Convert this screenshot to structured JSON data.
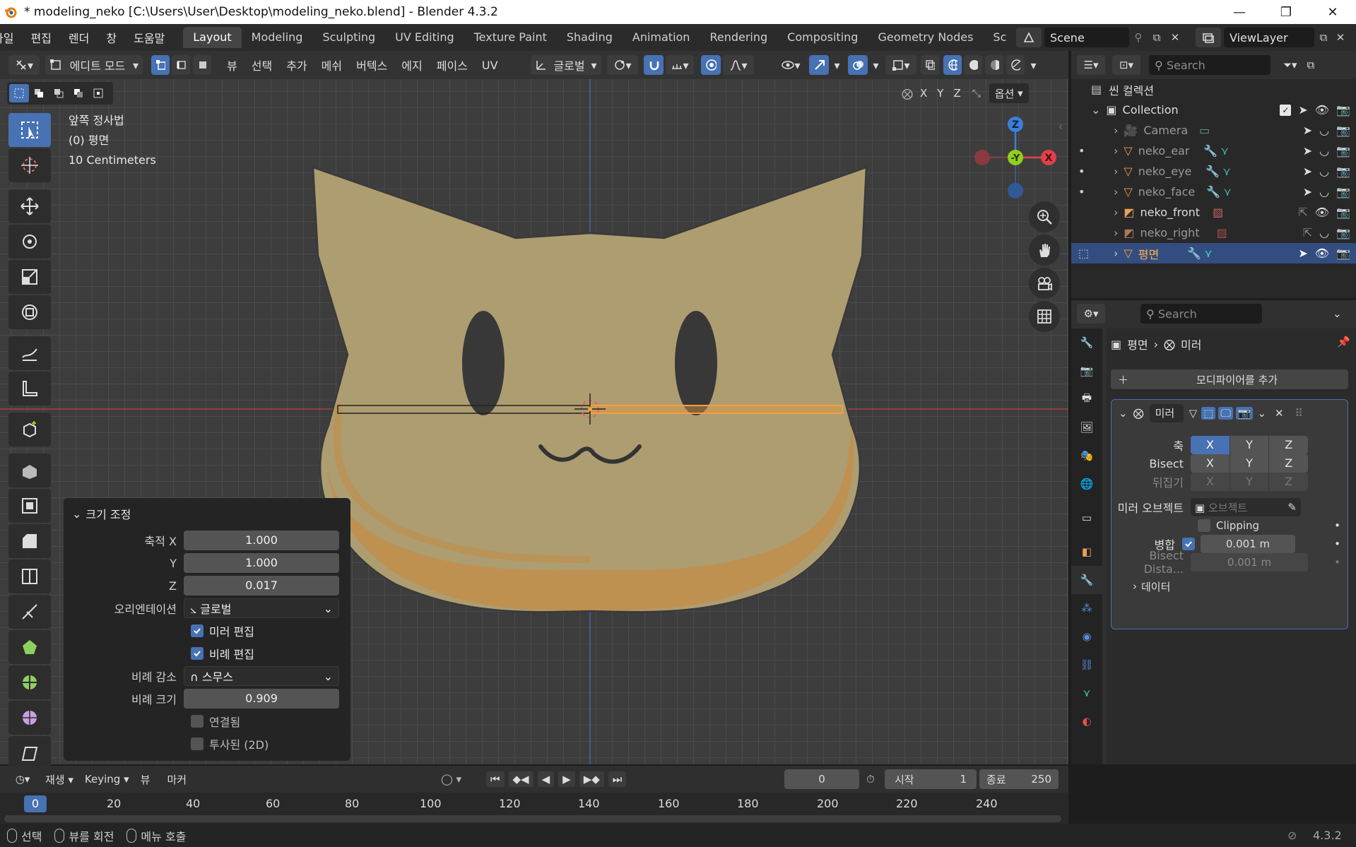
{
  "window": {
    "title": "* modeling_neko [C:\\Users\\User\\Desktop\\modeling_neko.blend] - Blender 4.3.2"
  },
  "menu": [
    "파일",
    "편집",
    "렌더",
    "창",
    "도움말"
  ],
  "workspaces": [
    "Layout",
    "Modeling",
    "Sculpting",
    "UV Editing",
    "Texture Paint",
    "Shading",
    "Animation",
    "Rendering",
    "Compositing",
    "Geometry Nodes",
    "Sc"
  ],
  "scene": {
    "name": "Scene",
    "view_layer": "ViewLayer"
  },
  "viewport_header": {
    "mode": "에디트 모드",
    "menus": [
      "뷰",
      "선택",
      "추가",
      "메쉬",
      "버텍스",
      "에지",
      "페이스",
      "UV"
    ],
    "orientation": "글로벌",
    "axes": [
      "X",
      "Y",
      "Z"
    ],
    "options": "옵션"
  },
  "viewport_info": {
    "view": "앞쪽 정사법",
    "object": "(0) 평면",
    "scale": "10 Centimeters"
  },
  "gizmo": {
    "z": "Z",
    "y": "-Y",
    "x": "X"
  },
  "operator_panel": {
    "title": "크기 조정",
    "scale_x_label": "축적 X",
    "scale_x": "1.000",
    "scale_y_label": "Y",
    "scale_y": "1.000",
    "scale_z_label": "Z",
    "scale_z": "0.017",
    "orientation_label": "오리엔테이션",
    "orientation": "글로벌",
    "mirror_edit": "미러 편집",
    "mirror_edit_checked": true,
    "proportional_edit": "비례 편집",
    "proportional_edit_checked": true,
    "falloff_label": "비례 감소",
    "falloff": "스무스",
    "prop_size_label": "비례 크기",
    "prop_size": "0.909",
    "connected": "연결됨",
    "connected_checked": false,
    "projected": "투사된 (2D)",
    "projected_checked": false
  },
  "outliner": {
    "search_placeholder": "Search",
    "scene_collection": "씬 컬렉션",
    "collection": "Collection",
    "items": [
      {
        "name": "Camera"
      },
      {
        "name": "neko_ear"
      },
      {
        "name": "neko_eye"
      },
      {
        "name": "neko_face"
      },
      {
        "name": "neko_front"
      },
      {
        "name": "neko_right"
      },
      {
        "name": "평면",
        "selected": true
      }
    ]
  },
  "properties": {
    "search_placeholder": "Search",
    "breadcrumb_object": "평면",
    "breadcrumb_modifier": "미러",
    "add_modifier": "모디파이어를 추가",
    "modifier_name": "미러",
    "axis_label": "축",
    "bisect_label": "Bisect",
    "flip_label": "뒤집기",
    "mirror_object_label": "미러 오브젝트",
    "mirror_object_placeholder": "오브젝트",
    "clipping_label": "Clipping",
    "merge_label": "병합",
    "merge_value": "0.001 m",
    "bisect_distance_label": "Bisect Dista...",
    "bisect_distance_value": "0.001 m",
    "data_label": "데이터",
    "x": "X",
    "y": "Y",
    "z": "Z"
  },
  "timeline": {
    "playback": "재생",
    "keying": "Keying",
    "view": "뷰",
    "marker": "마커",
    "current_frame": "0",
    "start_label": "시작",
    "start": "1",
    "end_label": "종료",
    "end": "250",
    "ruler": [
      "0",
      "20",
      "40",
      "60",
      "80",
      "100",
      "120",
      "140",
      "160",
      "180",
      "200",
      "220",
      "240"
    ]
  },
  "statusbar": {
    "select": "선택",
    "rotate_view": "뷰를 회전",
    "call_menu": "메뉴 호출",
    "version": "4.3.2"
  },
  "colors": {
    "accent": "#4772b3",
    "selection_orange": "#ffa033",
    "face_fill": "#b0a274",
    "x_axis": "#e0404a",
    "y_axis": "#8fcf1f",
    "z_axis": "#3c7fd6"
  }
}
